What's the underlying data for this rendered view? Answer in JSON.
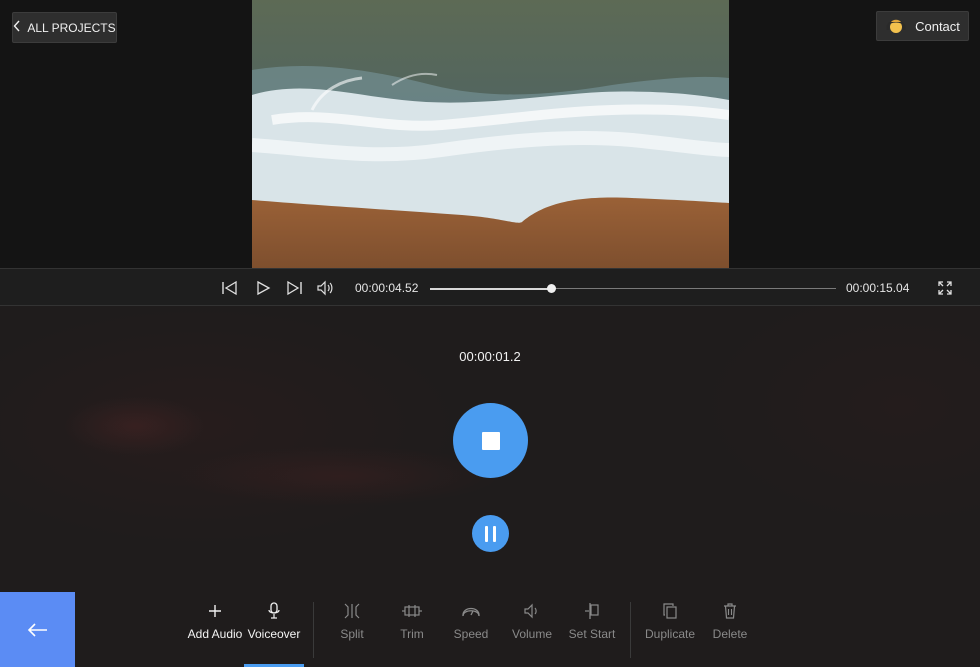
{
  "header": {
    "all_projects_label": "ALL PROJECTS",
    "contact_label": "Contact"
  },
  "playback": {
    "current_time": "00:00:04.52",
    "total_time": "00:00:15.04",
    "progress_fraction": 0.3
  },
  "recording": {
    "elapsed": "00:00:01.2"
  },
  "toolbar": {
    "tools": [
      {
        "id": "add-audio",
        "label": "Add Audio",
        "icon": "plus-icon",
        "enabled": true
      },
      {
        "id": "voiceover",
        "label": "Voiceover",
        "icon": "microphone-icon",
        "enabled": true,
        "active": true
      },
      {
        "id": "split",
        "label": "Split",
        "icon": "split-icon",
        "enabled": false
      },
      {
        "id": "trim",
        "label": "Trim",
        "icon": "trim-icon",
        "enabled": false
      },
      {
        "id": "speed",
        "label": "Speed",
        "icon": "speedometer-icon",
        "enabled": false
      },
      {
        "id": "volume",
        "label": "Volume",
        "icon": "speaker-icon",
        "enabled": false
      },
      {
        "id": "set-start",
        "label": "Set Start",
        "icon": "set-start-icon",
        "enabled": false
      },
      {
        "id": "duplicate",
        "label": "Duplicate",
        "icon": "duplicate-icon",
        "enabled": false
      },
      {
        "id": "delete",
        "label": "Delete",
        "icon": "trash-icon",
        "enabled": false
      }
    ]
  },
  "colors": {
    "accent": "#4a9cf0",
    "back_button": "#5b8cf4",
    "background": "#1a1a1a"
  }
}
